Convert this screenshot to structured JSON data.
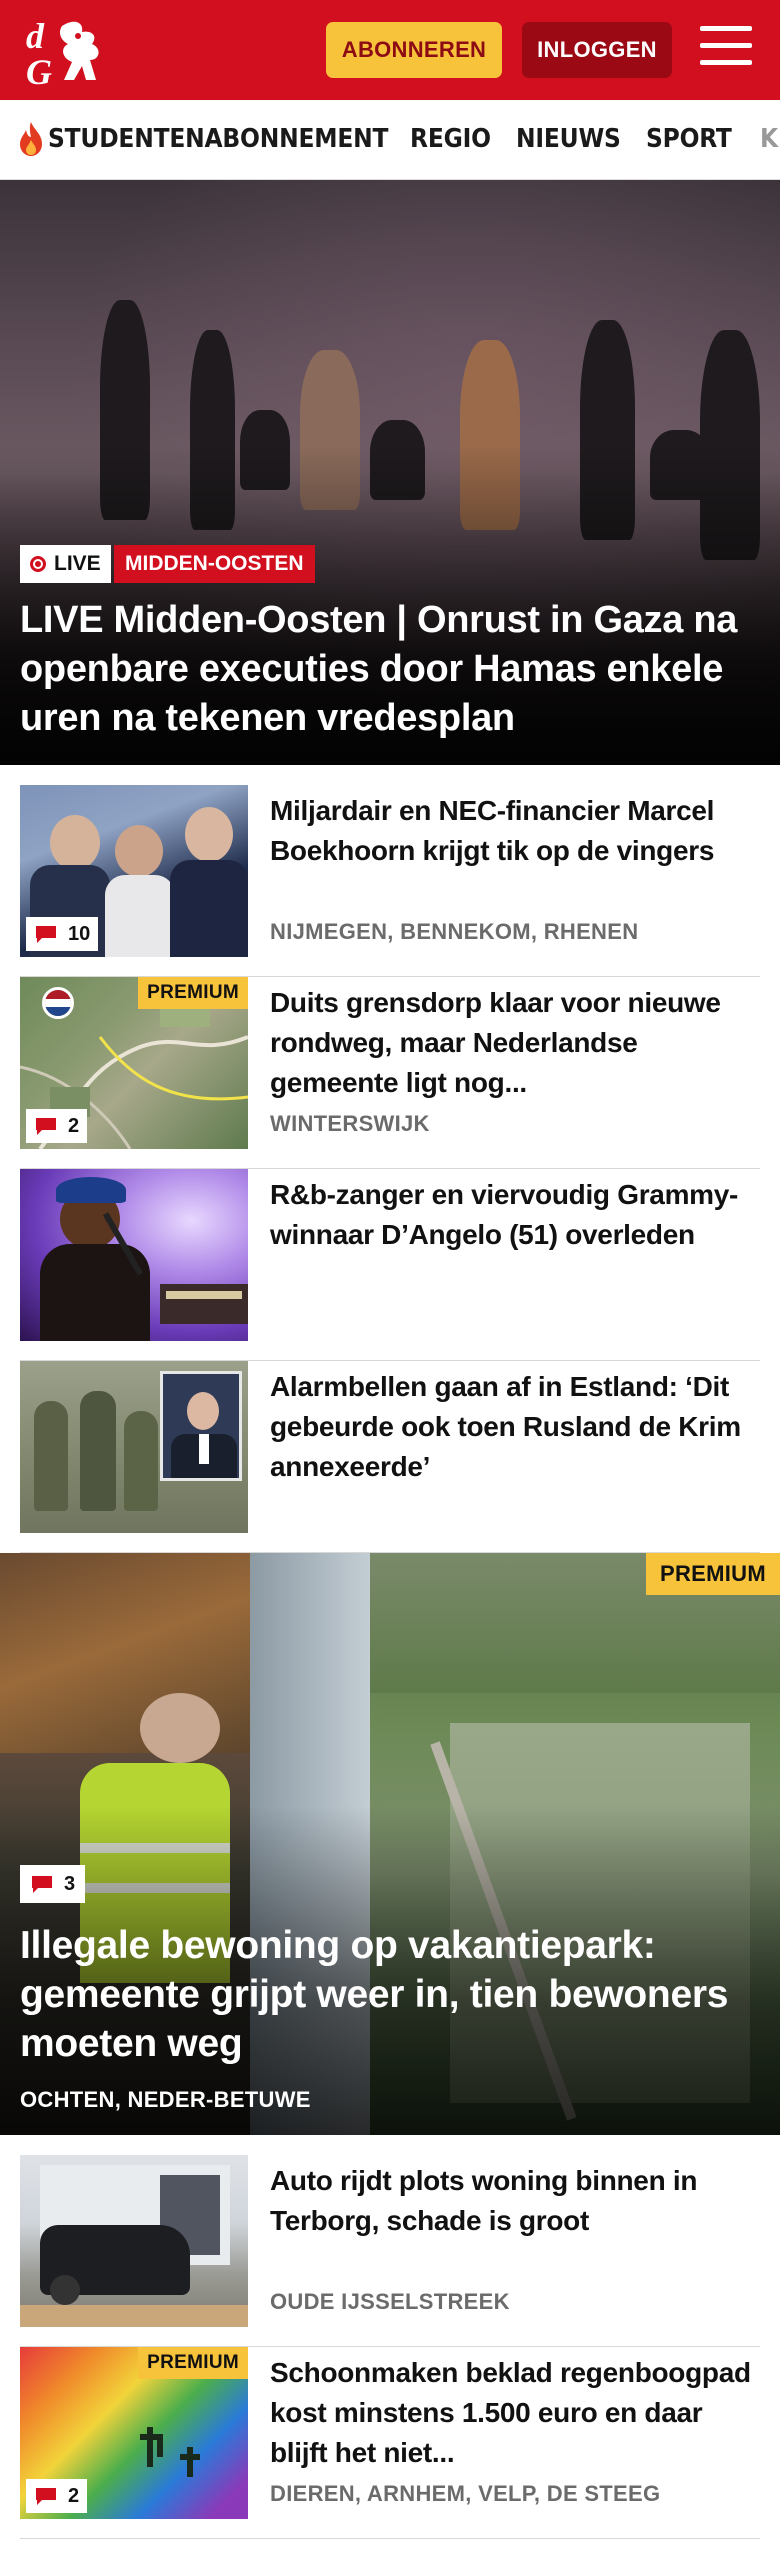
{
  "header": {
    "logo_alt": "dG",
    "subscribe_label": "ABONNEREN",
    "login_label": "INLOGGEN"
  },
  "nav": {
    "items": [
      "STUDENTENABONNEMENT",
      "REGIO",
      "NIEUWS",
      "SPORT",
      "K"
    ]
  },
  "hero": {
    "live_label": "LIVE",
    "category": "MIDDEN-OOSTEN",
    "title": "LIVE Midden-Oosten | Onrust in Gaza na openbare executies door Hamas enkele uren na tekenen vredesplan"
  },
  "articles": [
    {
      "title": "Miljardair en NEC-financier Marcel Boekhoorn krijgt tik op de vingers",
      "location": "NIJMEGEN, BENNEKOM, RHENEN",
      "comments": "10",
      "premium": ""
    },
    {
      "title": "Duits grensdorp klaar voor nieuwe rondweg, maar Nederlandse gemeente ligt nog...",
      "location": "WINTERSWIJK",
      "comments": "2",
      "premium": "PREMIUM"
    },
    {
      "title": "R&b-zanger en viervoudig Gram­my-winnaar D’Angelo (51) overleden",
      "location": "",
      "comments": "",
      "premium": ""
    },
    {
      "title": "Alarmbellen gaan af in Estland: ‘Dit gebeurde ook toen Rusland de Krim annexeerde’",
      "location": "",
      "comments": "",
      "premium": ""
    }
  ],
  "feature": {
    "premium": "PREMIUM",
    "comments": "3",
    "title": "Illegale bewoning op vakantiepark: gemeente grijpt weer in, tien bewoners moeten weg",
    "location": "OCHTEN, NEDER-BETUWE"
  },
  "articles2": [
    {
      "title": "Auto rijdt plots woning binnen in Terborg, schade is groot",
      "location": "OUDE IJSSELSTREEK",
      "comments": "",
      "premium": ""
    },
    {
      "title": "Schoonmaken beklad regenboogpad kost minstens 1.500 euro en daar blijft het niet...",
      "location": "DIEREN, ARNHEM, VELP, DE STEEG",
      "comments": "2",
      "premium": "PREMIUM"
    }
  ],
  "colors": {
    "brand_red": "#d10f1e",
    "accent_yellow": "#f7c33b",
    "dark_red": "#9b0a14"
  }
}
